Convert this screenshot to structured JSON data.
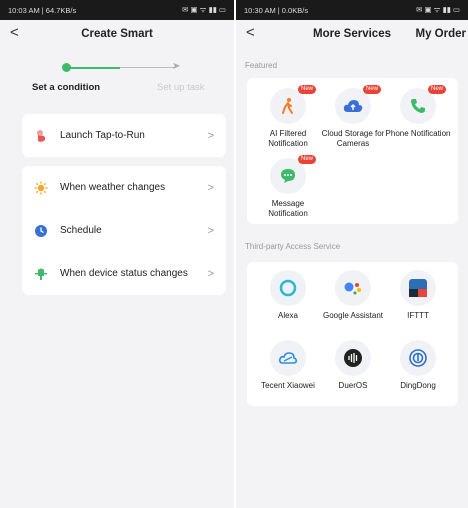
{
  "left": {
    "status": {
      "time": "10:03 AM | 64.7KB/s",
      "icons": "✉ ▣ ᯤ ▮▮ ▭"
    },
    "nav": {
      "back": "<",
      "title": "Create Smart"
    },
    "steps": {
      "step1": "Set a condition",
      "step2": "Set up task"
    },
    "rows": {
      "tap": "Launch Tap-to-Run",
      "weather": "When weather changes",
      "schedule": "Schedule",
      "device": "When device status changes"
    },
    "chevron": ">"
  },
  "right": {
    "status": {
      "time": "10:30 AM | 0.0KB/s",
      "icons": "✉ ▣ ᯤ ▮▮ ▭"
    },
    "nav": {
      "back": "<",
      "title": "More Services",
      "order": "My Order"
    },
    "featured_title": "Featured",
    "featured": [
      {
        "name": "AI Filtered Notification",
        "badge": "New",
        "icon": "walking-person-icon"
      },
      {
        "name": "Cloud Storage for Cameras",
        "badge": "New",
        "icon": "cloud-upload-icon"
      },
      {
        "name": "Phone Notification",
        "badge": "New",
        "icon": "phone-icon"
      },
      {
        "name": "Message Notification",
        "badge": "New",
        "icon": "chat-bubble-icon"
      }
    ],
    "third_title": "Third-party Access Service",
    "third": [
      {
        "name": "Alexa",
        "icon": "alexa-icon"
      },
      {
        "name": "Google Assistant",
        "icon": "google-assistant-icon"
      },
      {
        "name": "IFTTT",
        "icon": "ifttt-icon"
      },
      {
        "name": "Tecent Xiaowei",
        "icon": "xiaowei-icon"
      },
      {
        "name": "DuerOS",
        "icon": "dueros-icon"
      },
      {
        "name": "DingDong",
        "icon": "dingdong-icon"
      }
    ]
  },
  "colors": {
    "accent": "#3fb96a",
    "badge": "#ea4335"
  }
}
